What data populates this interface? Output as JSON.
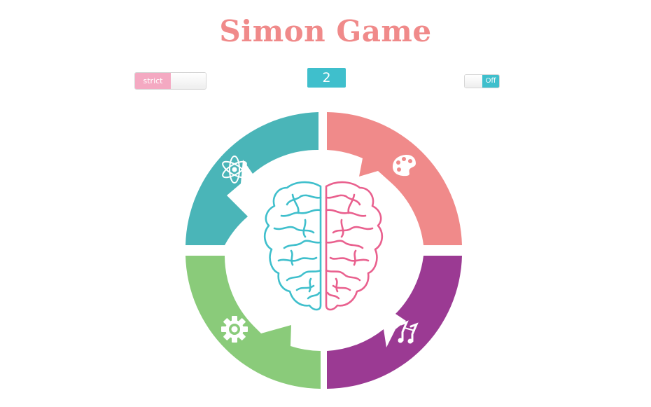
{
  "title": "Simon Game",
  "strict": {
    "label": "strict",
    "color": "#f4a9c2"
  },
  "counter": {
    "value": "2",
    "color": "#3fbfcc"
  },
  "power": {
    "label": "Off"
  },
  "pads": [
    {
      "name": "teal",
      "color": "#4ab5b8",
      "icon": "atom-icon"
    },
    {
      "name": "red",
      "color": "#f08a8a",
      "icon": "palette-icon"
    },
    {
      "name": "green",
      "color": "#8acb7a",
      "icon": "gear-icon"
    },
    {
      "name": "purple",
      "color": "#9b3a93",
      "icon": "music-notes-icon"
    }
  ],
  "brain": {
    "left_color": "#3fbfcc",
    "right_color": "#e9608e",
    "icon": "brain-icon"
  }
}
